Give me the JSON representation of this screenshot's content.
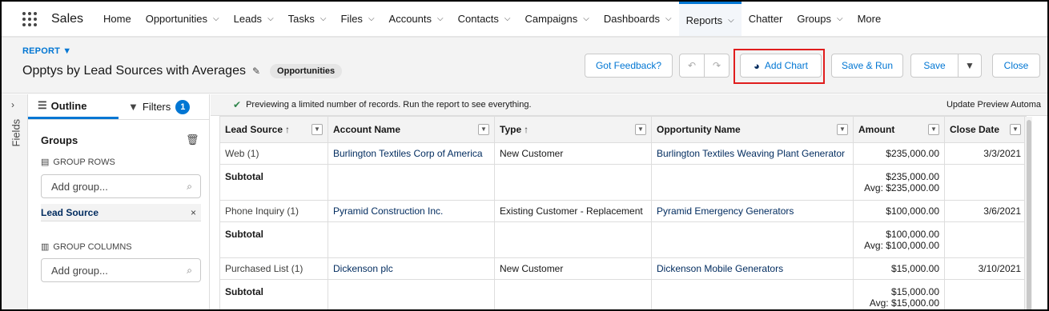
{
  "nav": {
    "app_name": "Sales",
    "items": [
      {
        "label": "Home",
        "chevron": false
      },
      {
        "label": "Opportunities",
        "chevron": true
      },
      {
        "label": "Leads",
        "chevron": true
      },
      {
        "label": "Tasks",
        "chevron": true
      },
      {
        "label": "Files",
        "chevron": true
      },
      {
        "label": "Accounts",
        "chevron": true
      },
      {
        "label": "Contacts",
        "chevron": true
      },
      {
        "label": "Campaigns",
        "chevron": true
      },
      {
        "label": "Dashboards",
        "chevron": true
      },
      {
        "label": "Reports",
        "chevron": true,
        "active": true
      },
      {
        "label": "Chatter",
        "chevron": false
      },
      {
        "label": "Groups",
        "chevron": true
      },
      {
        "label": "More",
        "chevron": false
      }
    ]
  },
  "header": {
    "kicker": "REPORT ▼",
    "title": "Opptys by Lead Sources with Averages",
    "type_pill": "Opportunities",
    "buttons": {
      "feedback": "Got Feedback?",
      "add_chart": "Add Chart",
      "save_run": "Save & Run",
      "save": "Save",
      "close": "Close"
    }
  },
  "rail": {
    "label": "Fields"
  },
  "outline": {
    "tab_outline": "Outline",
    "tab_filters": "Filters",
    "filter_count": "1",
    "groups_title": "Groups",
    "group_rows_label": "GROUP ROWS",
    "group_rows_placeholder": "Add group...",
    "group_chip": "Lead Source",
    "group_columns_label": "GROUP COLUMNS",
    "group_columns_placeholder": "Add group..."
  },
  "notice": {
    "text": "Previewing a limited number of records. Run the report to see everything.",
    "update": "Update Preview Automa"
  },
  "table": {
    "columns": [
      "Lead Source",
      "Account Name",
      "Type",
      "Opportunity Name",
      "Amount",
      "Close Date"
    ],
    "groups": [
      {
        "row": [
          "Web (1)",
          "Burlington Textiles Corp of America",
          "New Customer",
          "Burlington Textiles Weaving Plant Generator",
          "$235,000.00",
          "3/3/2021"
        ],
        "subtotal_label": "Subtotal",
        "subtotal_amount": "$235,000.00",
        "subtotal_avg": "Avg: $235,000.00"
      },
      {
        "row": [
          "Phone Inquiry (1)",
          "Pyramid Construction Inc.",
          "Existing Customer - Replacement",
          "Pyramid Emergency Generators",
          "$100,000.00",
          "3/6/2021"
        ],
        "subtotal_label": "Subtotal",
        "subtotal_amount": "$100,000.00",
        "subtotal_avg": "Avg: $100,000.00"
      },
      {
        "row": [
          "Purchased List (1)",
          "Dickenson plc",
          "New Customer",
          "Dickenson Mobile Generators",
          "$15,000.00",
          "3/10/2021"
        ],
        "subtotal_label": "Subtotal",
        "subtotal_amount": "$15,000.00",
        "subtotal_avg": "Avg: $15,000.00"
      }
    ]
  }
}
